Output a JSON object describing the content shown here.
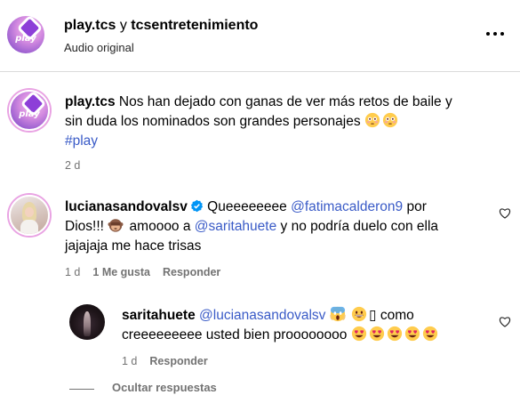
{
  "header": {
    "account": "play.tcs",
    "connector": " y ",
    "collaborator": "tcsentretenimiento",
    "audio": "Audio original",
    "avatar_text": "play"
  },
  "comments": [
    {
      "user": "play.tcs",
      "avatar_text": "play",
      "text_line1": " Nos han dejado con ganas de ver más retos de baile y",
      "text_line2": "sin duda los nominados son grandes personajes",
      "emoji": [
        "flushed-face",
        "flushed-face"
      ],
      "hashtag": "#play",
      "time": "2 d"
    },
    {
      "user": "lucianasandovalsv",
      "verified": true,
      "text_a": " Queeeeeeee ",
      "mention_1": "@fatimacalderon9",
      "text_b": " por",
      "text_c": "Dios!!! ",
      "emoji_1": "see-no-evil-monkey",
      "text_d": " amoooo a ",
      "mention_2": "@saritahuete",
      "text_e": " y no podría duelo con ella",
      "text_f": "jajajaja me hace trisas",
      "time": "1 d",
      "likes": "1 Me gusta",
      "reply": "Responder"
    },
    {
      "user": "saritahuete",
      "mention": "@lucianasandovalsv",
      "emoji_1": "face-screaming",
      "emoji_2": "grinning-face",
      "placeholder_glyph": "▯",
      "text_a": " como",
      "text_b": "creeeeeeeee usted bien proooooooo",
      "emojis_end": [
        "heart-eyes",
        "heart-eyes",
        "heart-eyes",
        "heart-eyes",
        "heart-eyes"
      ],
      "time": "1 d",
      "reply": "Responder"
    }
  ],
  "hide_replies": "Ocultar respuestas",
  "colors": {
    "mention": "#3a5bc7",
    "meta": "#737373",
    "verified": "#0095f6",
    "brand_gradient_start": "#f2c6ec",
    "brand_gradient_end": "#7a4fc0"
  }
}
